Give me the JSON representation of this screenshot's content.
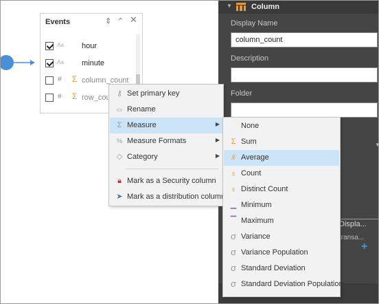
{
  "events_panel": {
    "title": "Events",
    "fields": [
      {
        "name": "hour",
        "type": "Aa",
        "checked": true
      },
      {
        "name": "minute",
        "type": "Aa",
        "checked": true
      },
      {
        "name": "column_count",
        "type": "#",
        "checked": false,
        "measure": true
      },
      {
        "name": "row_count",
        "type": "#",
        "checked": false,
        "measure": true
      }
    ]
  },
  "context_menu": {
    "items": [
      {
        "label": "Set primary key",
        "icon": "key-icon"
      },
      {
        "label": "Rename",
        "icon": "rename-icon"
      },
      {
        "label": "Measure",
        "icon": "sigma-icon",
        "has_submenu": true,
        "highlighted": true
      },
      {
        "label": "Measure Formats",
        "icon": "format-icon",
        "has_submenu": true
      },
      {
        "label": "Category",
        "icon": "category-icon",
        "has_submenu": true
      },
      {
        "label": "Mark as a Security column",
        "icon": "lock-icon"
      },
      {
        "label": "Mark as a distribution column",
        "icon": "send-icon"
      }
    ]
  },
  "submenu": {
    "items": [
      {
        "label": "None",
        "icon": ""
      },
      {
        "label": "Sum",
        "icon": "sigma-icon"
      },
      {
        "label": "Average",
        "icon": "average-icon",
        "highlighted": true
      },
      {
        "label": "Count",
        "icon": "count-icon"
      },
      {
        "label": "Distinct Count",
        "icon": "distinct-count-icon"
      },
      {
        "label": "Minimum",
        "icon": "minimum-icon"
      },
      {
        "label": "Maximum",
        "icon": "maximum-icon"
      },
      {
        "label": "Variance",
        "icon": "variance-icon"
      },
      {
        "label": "Variance Population",
        "icon": "variance-population-icon"
      },
      {
        "label": "Standard Deviation",
        "icon": "stddev-icon"
      },
      {
        "label": "Standard Deviation Population",
        "icon": "stddev-population-icon"
      }
    ]
  },
  "right_panel": {
    "section_title": "Column",
    "display_name_label": "Display Name",
    "display_name_value": "column_count",
    "description_label": "Description",
    "folder_label": "Folder",
    "grid_header": "Displa...",
    "grid_cell": "transa...",
    "add_label": "+"
  },
  "colors": {
    "accent": "#4a90d9",
    "menu_highlight": "#cce4f7",
    "measure_icon": "#e39a3c",
    "dark_panel": "#454545"
  }
}
